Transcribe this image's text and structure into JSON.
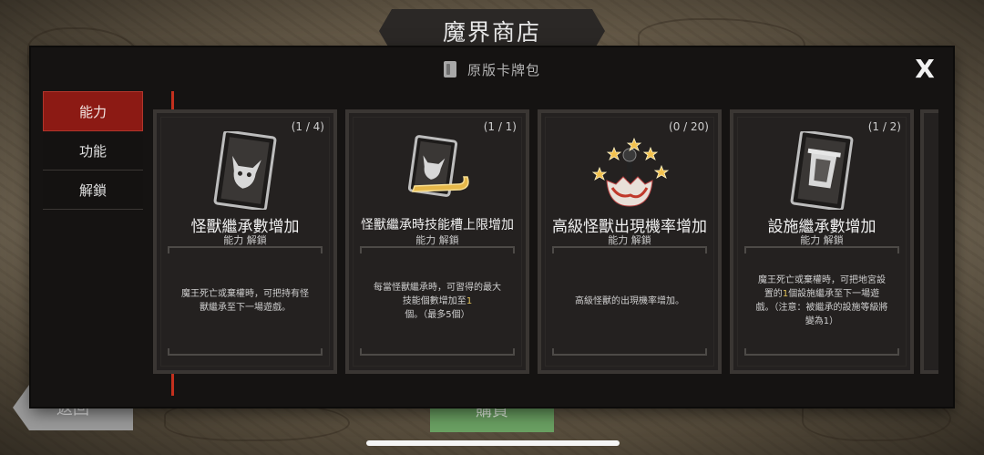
{
  "shop_title": "魔界商店",
  "dialog": {
    "pack_icon": "card-pack-icon",
    "title": "原版卡牌包",
    "close_icon": "close-icon",
    "close_label": "X"
  },
  "tabs": [
    {
      "label": "能力",
      "active": true
    },
    {
      "label": "功能",
      "active": false
    },
    {
      "label": "解鎖",
      "active": false
    }
  ],
  "cards": [
    {
      "count": "(1 / 4)",
      "icon": "monster-card-icon",
      "name": "怪獸繼承數增加",
      "sub": "能力 解鎖",
      "desc": "魔王死亡或棄權時，可把持有怪獸繼承至下一場遊戲。"
    },
    {
      "count": "(1 / 1)",
      "icon": "monster-card-scroll-icon",
      "name": "怪獸繼承時技能槽上限增加",
      "sub": "能力 解鎖",
      "desc_parts": [
        "每當怪獸繼承時，可習得的最大技能個數增加至",
        "1",
        "個。（最多5個）"
      ]
    },
    {
      "count": "(0 / 20)",
      "icon": "egg-hatch-stars-icon",
      "name": "高級怪獸出現機率增加",
      "sub": "能力 解鎖",
      "desc": "高級怪獸的出現機率增加。"
    },
    {
      "count": "(1 / 2)",
      "icon": "facility-card-icon",
      "name": "設施繼承數增加",
      "sub": "能力 解鎖",
      "desc_parts": [
        "魔王死亡或棄權時，可把地宮設置的",
        "1",
        "個設施繼承至下一場遊戲。（注意：被繼承的設施等級將變為1）"
      ]
    }
  ],
  "behind": {
    "back_label": "返回",
    "buy_label": "購買"
  },
  "colors": {
    "accent_red": "#c3301e",
    "tab_active": "#8c1a14",
    "highlight_number": "#e2c35b"
  }
}
